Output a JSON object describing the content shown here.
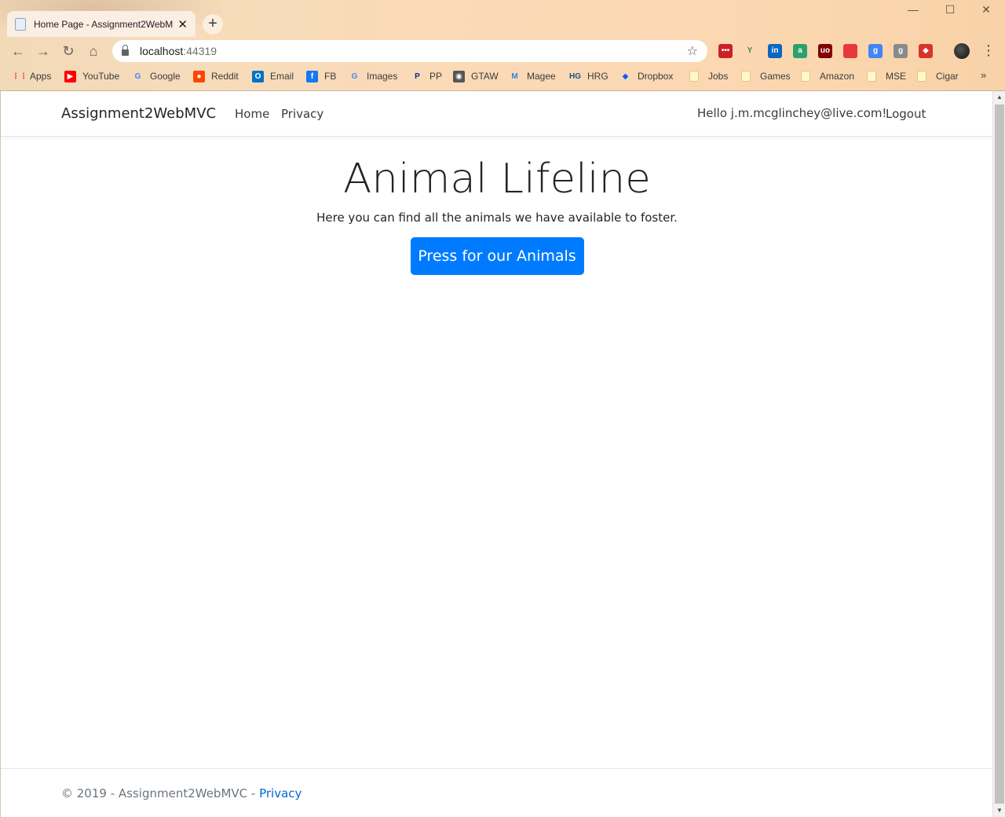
{
  "browser": {
    "tab_title": "Home Page - Assignment2WebMVC",
    "tab_close": "✕",
    "new_tab": "+",
    "window_controls": {
      "minimize": "—",
      "maximize": "☐",
      "close": "✕"
    },
    "nav": {
      "back": "←",
      "forward": "→",
      "reload": "↻",
      "home": "⌂"
    },
    "url_host": "localhost",
    "url_port": ":44319",
    "star": "☆",
    "menu": "⋮",
    "bookmarks_more": "»",
    "extensions": [
      {
        "icon": "lastpass-icon",
        "color": "#cc2029",
        "glyph": "•••"
      },
      {
        "icon": "leaf-icon",
        "color": "#ffffff",
        "glyph": "Y"
      },
      {
        "icon": "linkedin-icon",
        "color": "#0a66c2",
        "glyph": "in"
      },
      {
        "icon": "a-icon",
        "color": "#2aa26e",
        "glyph": "a"
      },
      {
        "icon": "ublock-icon",
        "color": "#800000",
        "glyph": "uo"
      },
      {
        "icon": "red-box-icon",
        "color": "#e8393a",
        "glyph": ""
      },
      {
        "icon": "google-apps-icon",
        "color": "#4285f4",
        "glyph": "g"
      },
      {
        "icon": "grey-g-icon",
        "color": "#8a8a8a",
        "glyph": "g"
      },
      {
        "icon": "red-badge-icon",
        "color": "#d8352a",
        "glyph": "◆"
      }
    ],
    "bookmarks": [
      {
        "label": "Apps",
        "icon": "apps-grid-icon",
        "color": "#e34c3b"
      },
      {
        "label": "YouTube",
        "icon": "youtube-icon",
        "color": "#ff0000"
      },
      {
        "label": "Google",
        "icon": "google-icon",
        "color": "#4285f4"
      },
      {
        "label": "Reddit",
        "icon": "reddit-icon",
        "color": "#ff4500"
      },
      {
        "label": "Email",
        "icon": "outlook-icon",
        "color": "#0072c6"
      },
      {
        "label": "FB",
        "icon": "facebook-icon",
        "color": "#1877f2"
      },
      {
        "label": "Images",
        "icon": "google-icon",
        "color": "#4285f4"
      },
      {
        "label": "PP",
        "icon": "paypal-icon",
        "color": "#003087"
      },
      {
        "label": "GTAW",
        "icon": "globe-icon",
        "color": "#555555"
      },
      {
        "label": "Magee",
        "icon": "m-icon",
        "color": "#2a8ad6"
      },
      {
        "label": "HRG",
        "icon": "hg-icon",
        "color": "#1b4f8a"
      },
      {
        "label": "Dropbox",
        "icon": "dropbox-icon",
        "color": "#0061ff"
      },
      {
        "label": "Jobs",
        "icon": "folder-icon"
      },
      {
        "label": "Games",
        "icon": "folder-icon"
      },
      {
        "label": "Amazon",
        "icon": "folder-icon"
      },
      {
        "label": "MSE",
        "icon": "folder-icon"
      },
      {
        "label": "Cigar",
        "icon": "folder-icon"
      }
    ]
  },
  "site": {
    "brand": "Assignment2WebMVC",
    "nav_home": "Home",
    "nav_privacy": "Privacy",
    "greeting": "Hello j.m.mcglinchey@live.com!",
    "logout": "Logout",
    "hero_title": "Animal Lifeline",
    "hero_text": "Here you can find all the animals we have available to foster.",
    "cta_label": "Press for our Animals",
    "footer_text": "© 2019 - Assignment2WebMVC - ",
    "footer_link": "Privacy",
    "colors": {
      "primary": "#007bff",
      "link": "#0366d6",
      "muted": "#6c757d"
    }
  }
}
